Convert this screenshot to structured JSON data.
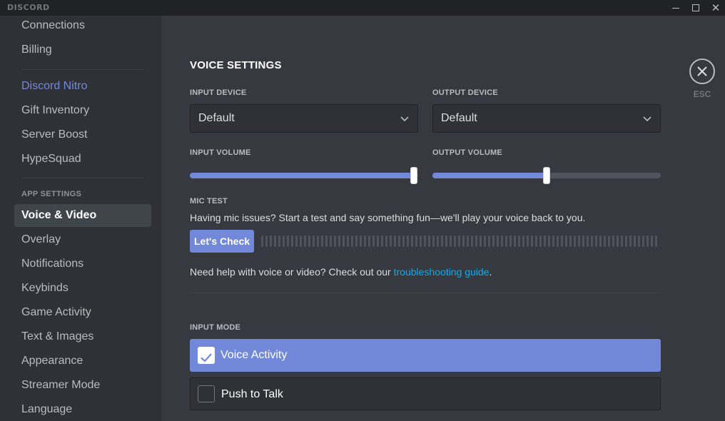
{
  "app": {
    "logo": "DISCORD"
  },
  "window_controls": {
    "min_icon": "minimize-icon",
    "max_icon": "maximize-icon",
    "close_icon": "close-icon",
    "close_glyph": "✕"
  },
  "sidebar": {
    "items_top": [
      "Connections",
      "Billing"
    ],
    "items_nitro": [
      "Discord Nitro",
      "Gift Inventory",
      "Server Boost",
      "HypeSquad"
    ],
    "app_settings_header": "APP SETTINGS",
    "items_app": [
      "Voice & Video",
      "Overlay",
      "Notifications",
      "Keybinds",
      "Game Activity",
      "Text & Images",
      "Appearance",
      "Streamer Mode",
      "Language"
    ],
    "active": "Voice & Video"
  },
  "voice": {
    "title": "VOICE SETTINGS",
    "input_device_label": "INPUT DEVICE",
    "input_device_value": "Default",
    "output_device_label": "OUTPUT DEVICE",
    "output_device_value": "Default",
    "input_volume_label": "INPUT VOLUME",
    "input_volume_fraction": 0.98,
    "output_volume_label": "OUTPUT VOLUME",
    "output_volume_fraction": 0.5,
    "mic_test_label": "MIC TEST",
    "mic_test_desc": "Having mic issues? Start a test and say something fun—we'll play your voice back to you.",
    "check_button": "Let's Check",
    "help_prefix": "Need help with voice or video? Check out our ",
    "help_link": "troubleshooting guide",
    "help_suffix": ".",
    "input_mode_label": "INPUT MODE",
    "input_modes": [
      "Voice Activity",
      "Push to Talk"
    ],
    "selected_mode": "Voice Activity"
  },
  "esc": {
    "label": "ESC"
  },
  "colors": {
    "accent": "#7289da",
    "link": "#00b0f4",
    "background": "#36393f",
    "sidebar": "#2f3136"
  }
}
